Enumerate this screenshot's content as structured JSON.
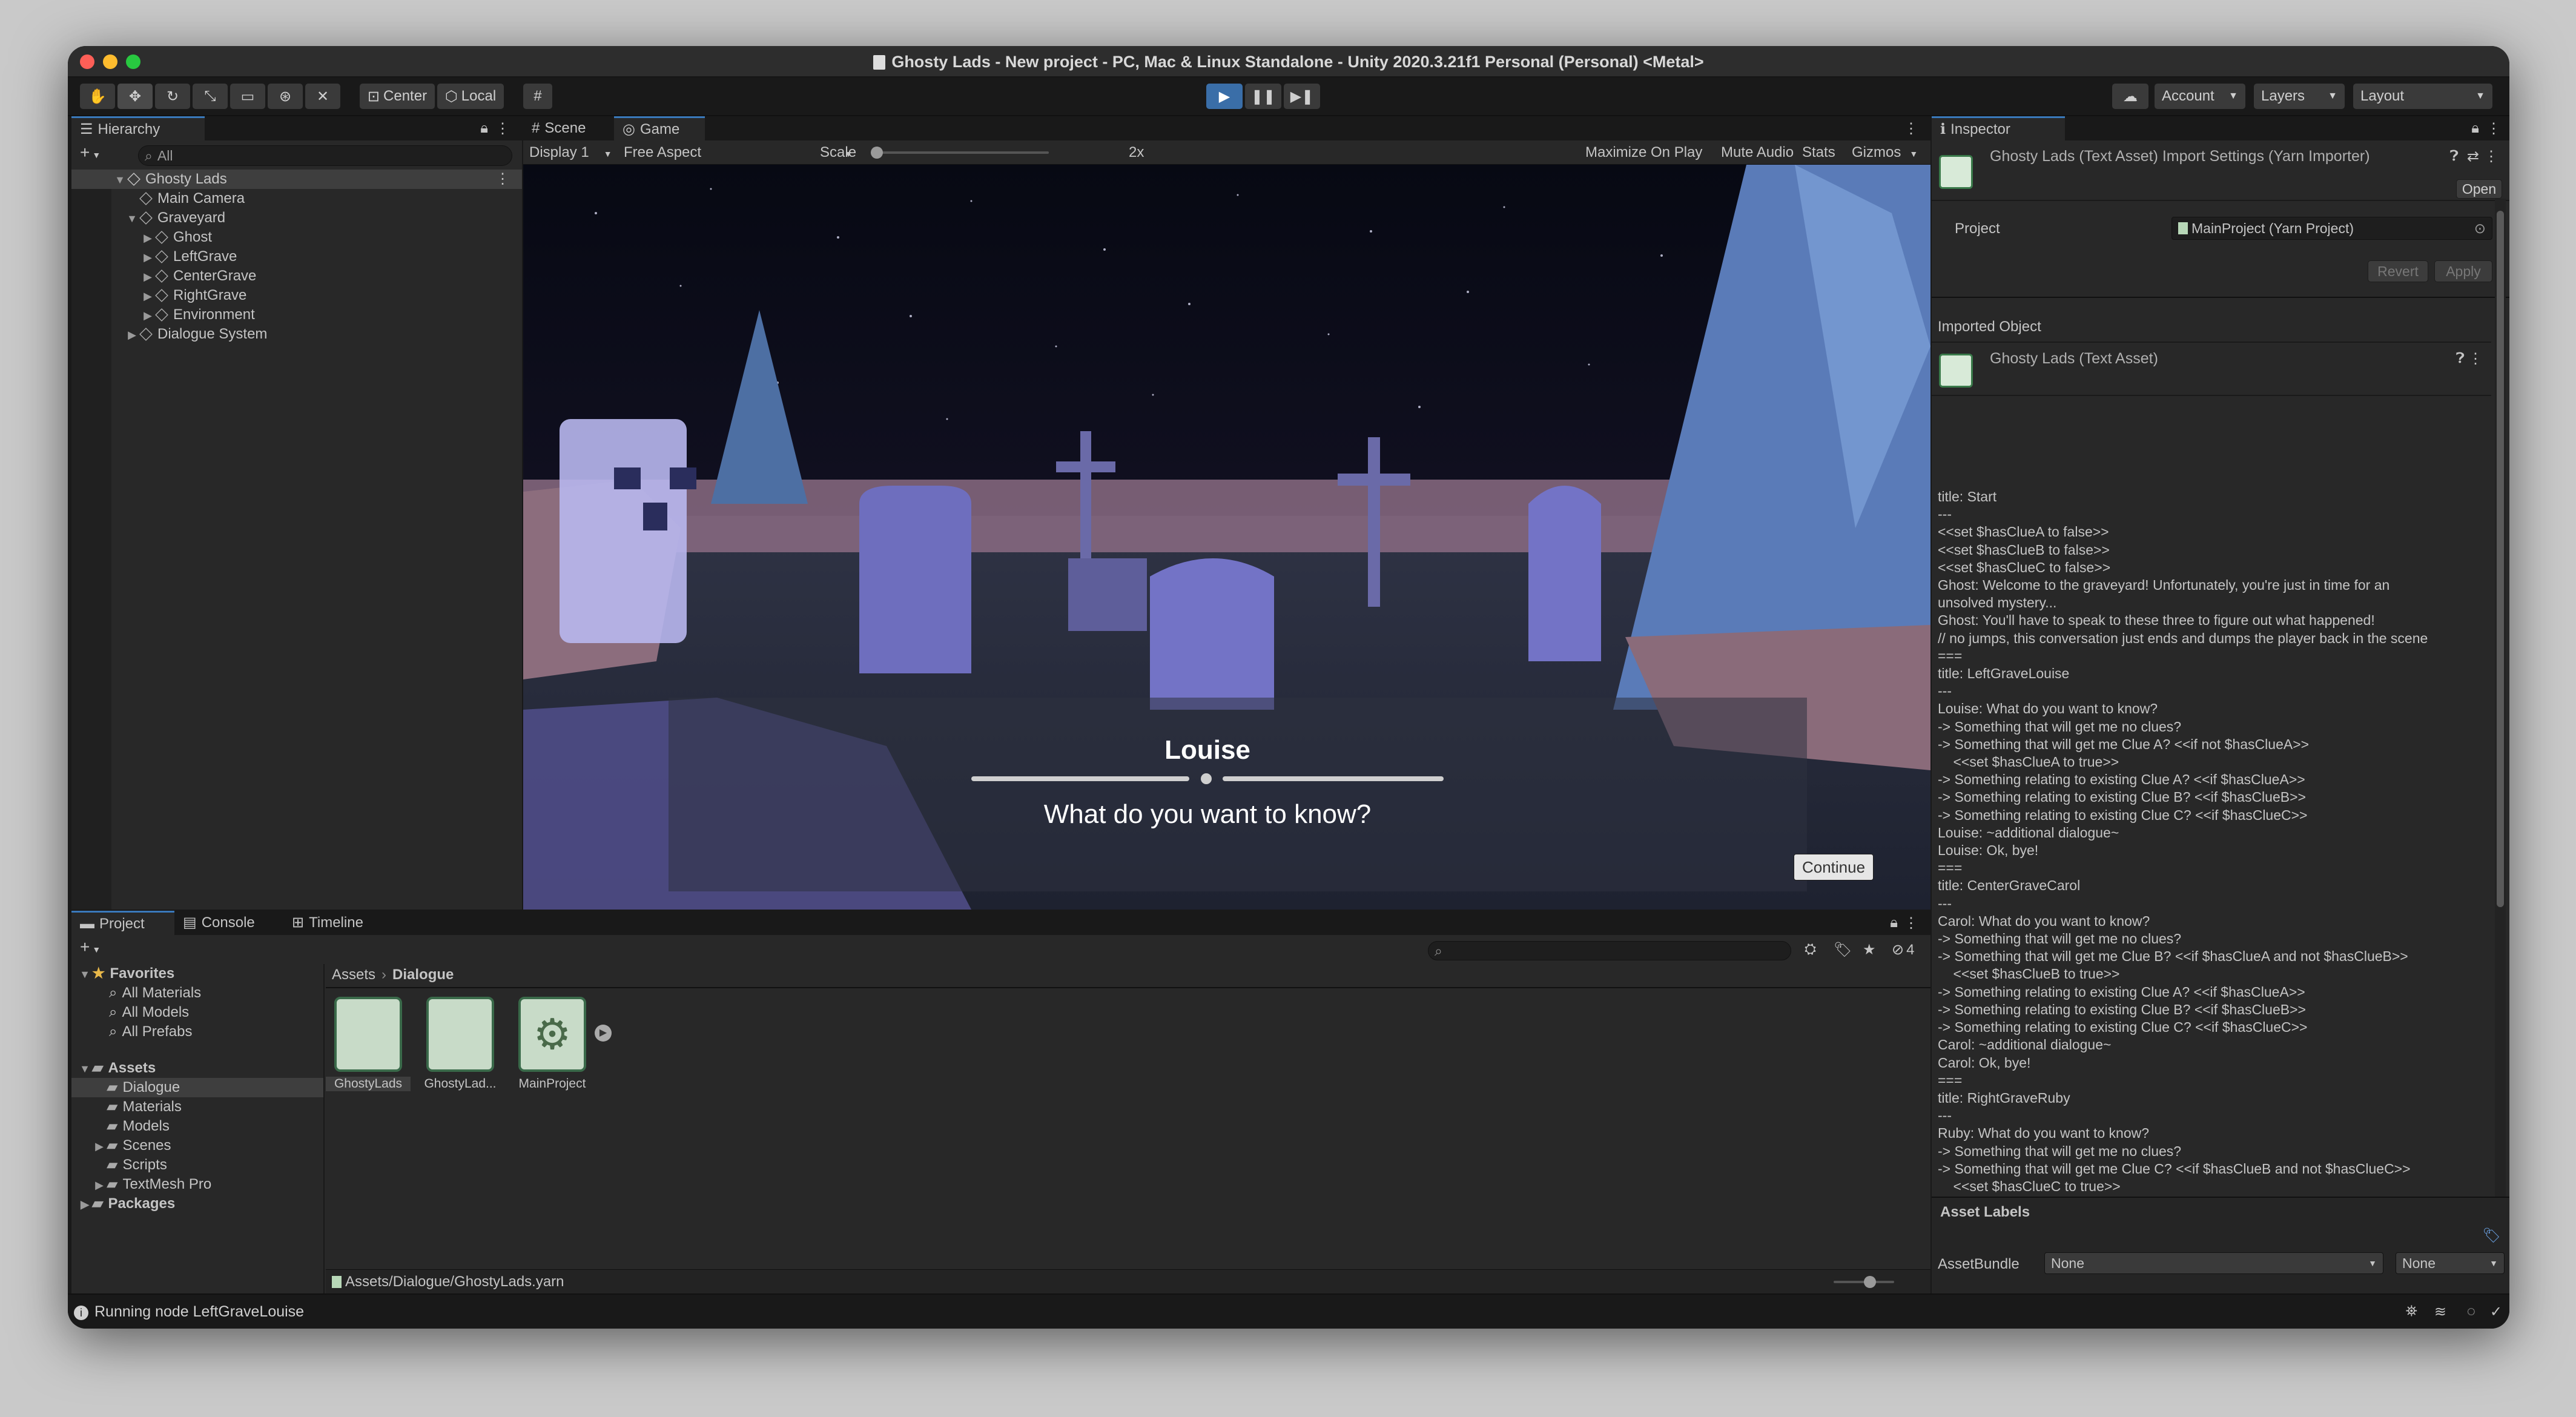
{
  "window": {
    "title": "Ghosty Lads - New project - PC, Mac & Linux Standalone - Unity 2020.3.21f1 Personal (Personal) <Metal>"
  },
  "toolbar": {
    "pivot_center": "Center",
    "pivot_local": "Local",
    "account": "Account",
    "layers": "Layers",
    "layout": "Layout"
  },
  "hierarchy": {
    "tab": "Hierarchy",
    "search_placeholder": "All",
    "items": [
      {
        "label": "Ghosty Lads"
      },
      {
        "label": "Main Camera"
      },
      {
        "label": "Graveyard"
      },
      {
        "label": "Ghost"
      },
      {
        "label": "LeftGrave"
      },
      {
        "label": "CenterGrave"
      },
      {
        "label": "RightGrave"
      },
      {
        "label": "Environment"
      },
      {
        "label": "Dialogue System"
      }
    ]
  },
  "view": {
    "tab_scene": "Scene",
    "tab_game": "Game",
    "display": "Display 1",
    "aspect": "Free Aspect",
    "scale_label": "Scale",
    "scale_value": "2x",
    "maximize": "Maximize On Play",
    "mute": "Mute Audio",
    "stats": "Stats",
    "gizmos": "Gizmos"
  },
  "dialogue": {
    "speaker": "Louise",
    "line": "What do you want to know?",
    "continue": "Continue"
  },
  "project": {
    "tab_project": "Project",
    "tab_console": "Console",
    "tab_timeline": "Timeline",
    "hidden_count": "4",
    "favorites_label": "Favorites",
    "favorites": [
      "All Materials",
      "All Models",
      "All Prefabs"
    ],
    "assets_label": "Assets",
    "folders": [
      "Dialogue",
      "Materials",
      "Models",
      "Scenes",
      "Scripts",
      "TextMesh Pro"
    ],
    "packages_label": "Packages",
    "breadcrumb_root": "Assets",
    "breadcrumb_current": "Dialogue",
    "assets": [
      {
        "label": "GhostyLads"
      },
      {
        "label": "GhostyLad..."
      },
      {
        "label": "MainProject"
      }
    ],
    "path": "Assets/Dialogue/GhostyLads.yarn"
  },
  "inspector": {
    "tab": "Inspector",
    "header_title": "Ghosty Lads (Text Asset) Import Settings (Yarn Importer)",
    "open": "Open",
    "project_label": "Project",
    "project_value": "MainProject (Yarn Project)",
    "revert": "Revert",
    "apply": "Apply",
    "imported_object": "Imported Object",
    "object_title": "Ghosty Lads (Text Asset)",
    "yarn_text": "title: Start\n---\n<<set $hasClueA to false>>\n<<set $hasClueB to false>>\n<<set $hasClueC to false>>\nGhost: Welcome to the graveyard! Unfortunately, you're just in time for an\nunsolved mystery...\nGhost: You'll have to speak to these three to figure out what happened!\n// no jumps, this conversation just ends and dumps the player back in the scene\n===\ntitle: LeftGraveLouise\n---\nLouise: What do you want to know?\n-> Something that will get me no clues?\n-> Something that will get me Clue A? <<if not $hasClueA>>\n    <<set $hasClueA to true>>\n-> Something relating to existing Clue A? <<if $hasClueA>>\n-> Something relating to existing Clue B? <<if $hasClueB>>\n-> Something relating to existing Clue C? <<if $hasClueC>>\nLouise: ~additional dialogue~\nLouise: Ok, bye!\n===\ntitle: CenterGraveCarol\n---\nCarol: What do you want to know?\n-> Something that will get me no clues?\n-> Something that will get me Clue B? <<if $hasClueA and not $hasClueB>>\n    <<set $hasClueB to true>>\n-> Something relating to existing Clue A? <<if $hasClueA>>\n-> Something relating to existing Clue B? <<if $hasClueB>>\n-> Something relating to existing Clue C? <<if $hasClueC>>\nCarol: ~additional dialogue~\nCarol: Ok, bye!\n===\ntitle: RightGraveRuby\n---\nRuby: What do you want to know?\n-> Something that will get me no clues?\n-> Something that will get me Clue C? <<if $hasClueB and not $hasClueC>>\n    <<set $hasClueC to true>>\n-> Something relating to existing Clue A? <<if $hasClueA>>\n-> Something relating to existing Clue B? <<if $hasClueB>>\n-> Something relating to existing Clue C? <<if $hasClueC>>\nRuby: ~additional dialogue~\nRuby: Ok, bye!",
    "asset_labels": "Asset Labels",
    "assetbundle_label": "AssetBundle",
    "assetbundle_value": "None",
    "variant_value": "None"
  },
  "status": {
    "text": "Running node LeftGraveLouise"
  }
}
